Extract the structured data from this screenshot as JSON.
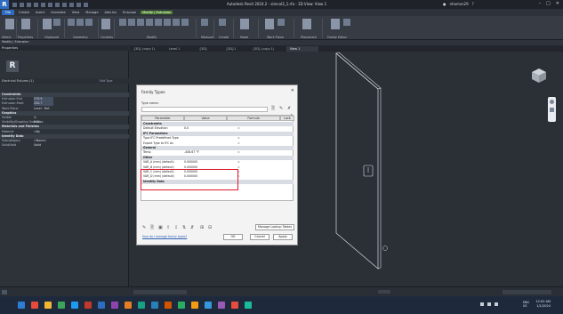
{
  "title_bar": {
    "logo": "R",
    "title": "Autodesk Revit 2024.2 - simcol3_1.rfa - 3D View: View 1",
    "user": "nhomsn29",
    "window_controls": [
      "–",
      "□",
      "✕"
    ]
  },
  "menu": {
    "tabs": [
      "File",
      "Create",
      "Insert",
      "Annotate",
      "View",
      "Manage",
      "Add-Ins",
      "Enscape",
      "Modify | Extrusion"
    ],
    "active_tab": "Modify | Extrusion"
  },
  "ribbon": {
    "groups": [
      "Select",
      "Properties",
      "Clipboard",
      "Geometry",
      "Controls",
      "Modify",
      "Measure",
      "Create",
      "Mode",
      "Work Plane",
      "Placement",
      "Family Editor"
    ]
  },
  "context_bar": {
    "label": "Modify | Extrusion"
  },
  "properties": {
    "header": "Properties",
    "type_selector": "Electrical Fixtures (1)",
    "edit_type": "Edit Type",
    "rows": [
      {
        "label": "Constraints",
        "section": true
      },
      {
        "label": "Extrusion End",
        "value": "279.9"
      },
      {
        "label": "Extrusion Start",
        "value": "250.7"
      },
      {
        "label": "Work Plane",
        "value": "Level : Ref. Level"
      },
      {
        "label": "Graphics",
        "section": true
      },
      {
        "label": "Visible",
        "value": "☑"
      },
      {
        "label": "Visibility/Graphics Overrides",
        "value": "Edit..."
      },
      {
        "label": "Materials and Finishes",
        "section": true
      },
      {
        "label": "Material",
        "value": "<By Category>"
      },
      {
        "label": "Identity Data",
        "section": true
      },
      {
        "label": "Subcategory",
        "value": "<None>"
      },
      {
        "label": "Solid/Void",
        "value": "Solid"
      }
    ]
  },
  "view_tabs": [
    "{3D} (copy 1)",
    "Level 1",
    "{3D}",
    "{3D}1",
    "{3D} (copy 1)",
    "View 1"
  ],
  "dialog": {
    "title": "Family Types",
    "type_name_label": "Type name:",
    "search_placeholder": "Search parameters",
    "columns": [
      "Parameter",
      "Value",
      "Formula",
      "Lock"
    ],
    "rows": [
      {
        "label": "Constraints",
        "section": true
      },
      {
        "label": "Default Elevation",
        "value": "0.0",
        "formula": "="
      },
      {
        "label": "IFC Parameters",
        "section": true
      },
      {
        "label": "Type IFC Predefined Type",
        "value": "",
        "formula": "="
      },
      {
        "label": "Export Type to IFC As",
        "value": "",
        "formula": "="
      },
      {
        "label": "General",
        "section": true
      },
      {
        "label": "Temp",
        "value": "-408.67 °F",
        "formula": "="
      },
      {
        "label": "Other",
        "section": true
      },
      {
        "label": "VAR_A (mm) (default)",
        "value": "0.000000",
        "formula": "="
      },
      {
        "label": "VAR_B (mm) (default)",
        "value": "0.000000",
        "formula": "="
      },
      {
        "label": "VAR_C (mm) (default)",
        "value": "0.000000",
        "formula": "="
      },
      {
        "label": "VAR_D (mm) (default)",
        "value": "0.000000",
        "formula": "="
      },
      {
        "label": "Identity Data",
        "section": true
      }
    ],
    "manage_lookup": "Manage Lookup Tables",
    "help_link": "How do I manage family types?",
    "ok": "OK",
    "cancel": "Cancel",
    "apply": "Apply"
  },
  "taskbar": {
    "time": "12:00 AM",
    "date": "1/1/2024",
    "lang": "ENG\nUS",
    "icon_colors": [
      "#2d7dd2",
      "#e84b3c",
      "#f2b632",
      "#3ba55c",
      "#1d9bf0",
      "#c0392b",
      "#2d6cc0",
      "#8e44ad",
      "#e67e22",
      "#16a085",
      "#2980b9",
      "#d35400",
      "#27ae60",
      "#f39c12",
      "#3498db",
      "#9b59b6",
      "#e74c3c",
      "#1abc9c"
    ]
  }
}
